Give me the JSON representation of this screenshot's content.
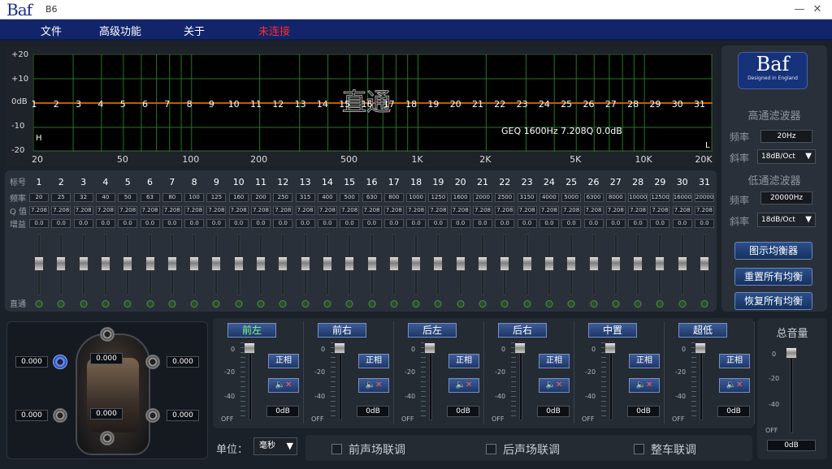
{
  "titlebar": {
    "logo": "Baf",
    "title": "B6",
    "minimize": "—",
    "close": "✕"
  },
  "menu": {
    "items": [
      "文件",
      "高级功能",
      "关于"
    ],
    "connection": "未连接"
  },
  "graph": {
    "y_labels": [
      "+20",
      "+10",
      "0dB",
      "-10",
      "-20"
    ],
    "x_labels": [
      "20",
      "50",
      "100",
      "200",
      "500",
      "1K",
      "2K",
      "5K",
      "10K",
      "20K"
    ],
    "band_numbers": [
      "1",
      "2",
      "3",
      "4",
      "5",
      "6",
      "7",
      "8",
      "9",
      "10",
      "11",
      "12",
      "13",
      "14",
      "15",
      "16",
      "17",
      "18",
      "19",
      "20",
      "21",
      "22",
      "23",
      "24",
      "25",
      "26",
      "27",
      "28",
      "29",
      "30",
      "31"
    ],
    "watermark": "直通",
    "info": "GEQ 1600Hz 7.208Q 0.0dB",
    "h_mark": "H",
    "l_mark": "L",
    "line_color": "#c85a00",
    "grid_color": "#1f7a1f"
  },
  "eq": {
    "row_labels": {
      "index": "标号",
      "freq": "频率",
      "q": "Q 值",
      "gain": "增益",
      "bypass": "直通"
    },
    "bands": [
      {
        "n": "1",
        "f": "20",
        "q": "7.208",
        "g": "0.0"
      },
      {
        "n": "2",
        "f": "25",
        "q": "7.208",
        "g": "0.0"
      },
      {
        "n": "3",
        "f": "32",
        "q": "7.208",
        "g": "0.0"
      },
      {
        "n": "4",
        "f": "40",
        "q": "7.208",
        "g": "0.0"
      },
      {
        "n": "5",
        "f": "50",
        "q": "7.208",
        "g": "0.0"
      },
      {
        "n": "6",
        "f": "63",
        "q": "7.208",
        "g": "0.0"
      },
      {
        "n": "7",
        "f": "80",
        "q": "7.208",
        "g": "0.0"
      },
      {
        "n": "8",
        "f": "100",
        "q": "7.208",
        "g": "0.0"
      },
      {
        "n": "9",
        "f": "125",
        "q": "7.208",
        "g": "0.0"
      },
      {
        "n": "10",
        "f": "160",
        "q": "7.208",
        "g": "0.0"
      },
      {
        "n": "11",
        "f": "200",
        "q": "7.208",
        "g": "0.0"
      },
      {
        "n": "12",
        "f": "250",
        "q": "7.208",
        "g": "0.0"
      },
      {
        "n": "13",
        "f": "315",
        "q": "7.208",
        "g": "0.0"
      },
      {
        "n": "14",
        "f": "400",
        "q": "7.208",
        "g": "0.0"
      },
      {
        "n": "15",
        "f": "500",
        "q": "7.208",
        "g": "0.0"
      },
      {
        "n": "16",
        "f": "630",
        "q": "7.208",
        "g": "0.0"
      },
      {
        "n": "17",
        "f": "800",
        "q": "7.208",
        "g": "0.0"
      },
      {
        "n": "18",
        "f": "1000",
        "q": "7.208",
        "g": "0.0"
      },
      {
        "n": "19",
        "f": "1250",
        "q": "7.208",
        "g": "0.0"
      },
      {
        "n": "20",
        "f": "1600",
        "q": "7.208",
        "g": "0.0"
      },
      {
        "n": "21",
        "f": "2000",
        "q": "7.208",
        "g": "0.0"
      },
      {
        "n": "22",
        "f": "2500",
        "q": "7.208",
        "g": "0.0"
      },
      {
        "n": "23",
        "f": "3150",
        "q": "7.208",
        "g": "0.0"
      },
      {
        "n": "24",
        "f": "4000",
        "q": "7.208",
        "g": "0.0"
      },
      {
        "n": "25",
        "f": "5000",
        "q": "7.208",
        "g": "0.0"
      },
      {
        "n": "26",
        "f": "6300",
        "q": "7.208",
        "g": "0.0"
      },
      {
        "n": "27",
        "f": "8000",
        "q": "7.208",
        "g": "0.0"
      },
      {
        "n": "28",
        "f": "10000",
        "q": "7.208",
        "g": "0.0"
      },
      {
        "n": "29",
        "f": "12500",
        "q": "7.208",
        "g": "0.0"
      },
      {
        "n": "30",
        "f": "16000",
        "q": "7.208",
        "g": "0.0"
      },
      {
        "n": "31",
        "f": "20000",
        "q": "7.208",
        "g": "0.0"
      }
    ]
  },
  "right": {
    "logo": "Baf",
    "logo_sub": "Designed in England",
    "hp_title": "高通滤波器",
    "freq_label": "频率",
    "slope_label": "斜率",
    "hp_freq": "20Hz",
    "hp_slope": "18dB/Oct",
    "lp_title": "低通滤波器",
    "lp_freq": "20000Hz",
    "lp_slope": "18dB/Oct",
    "btn_graphic": "图示均衡器",
    "btn_reset": "重置所有均衡",
    "btn_restore": "恢复所有均衡",
    "arrow": "▼"
  },
  "car": {
    "delays": [
      "0.000",
      "0.000",
      "0.000",
      "0.000",
      "0.000",
      "0.000"
    ]
  },
  "channels": {
    "scale": [
      "0",
      "-20",
      "-40",
      "OFF"
    ],
    "phase": "正相",
    "mute": "🔈✕",
    "db": "0dB",
    "names": [
      "前左",
      "前右",
      "后左",
      "后右",
      "中置",
      "超低"
    ]
  },
  "master": {
    "title": "总音量",
    "scale": [
      "0",
      "-20",
      "-40",
      "OFF"
    ],
    "db": "0dB"
  },
  "bottom": {
    "unit_label": "单位：",
    "unit_value": "毫秒",
    "arrow": "▼",
    "links": [
      "前声场联调",
      "后声场联调",
      "整车联调"
    ]
  }
}
